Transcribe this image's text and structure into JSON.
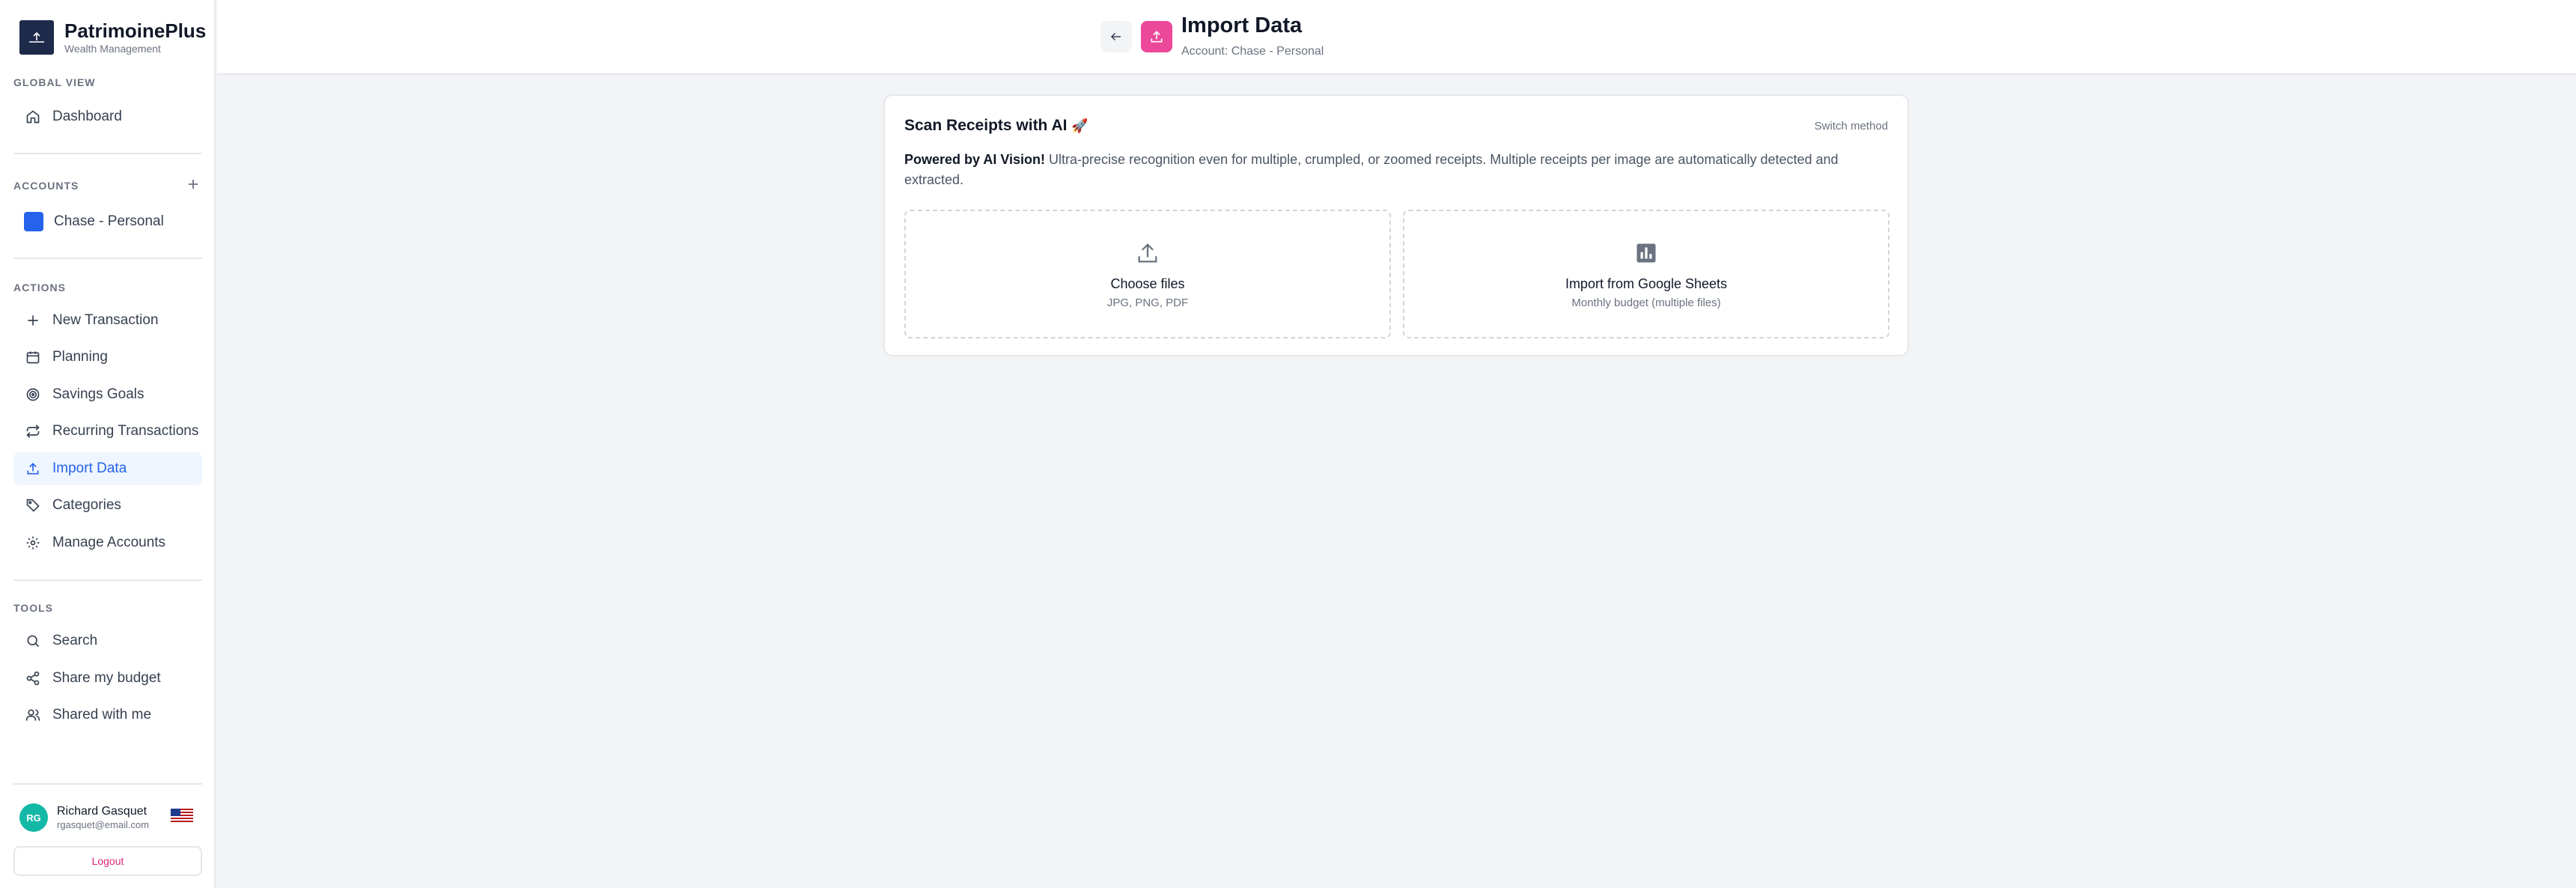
{
  "brand": {
    "name": "PatrimoinePlus",
    "subtitle": "Wealth Management"
  },
  "sidebar": {
    "global_view_title": "GLOBAL VIEW",
    "dashboard_label": "Dashboard",
    "accounts_title": "ACCOUNTS",
    "accounts": [
      {
        "label": "Chase - Personal",
        "color": "#2563eb"
      }
    ],
    "actions_title": "ACTIONS",
    "actions": [
      {
        "label": "New Transaction",
        "icon": "plus-icon"
      },
      {
        "label": "Planning",
        "icon": "calendar-icon"
      },
      {
        "label": "Savings Goals",
        "icon": "target-icon"
      },
      {
        "label": "Recurring Transactions",
        "icon": "repeat-icon"
      },
      {
        "label": "Import Data",
        "icon": "upload-icon",
        "active": true
      },
      {
        "label": "Categories",
        "icon": "tag-icon"
      },
      {
        "label": "Manage Accounts",
        "icon": "gear-icon"
      }
    ],
    "tools_title": "TOOLS",
    "tools": [
      {
        "label": "Search",
        "icon": "search-icon"
      },
      {
        "label": "Share my budget",
        "icon": "share-icon"
      },
      {
        "label": "Shared with me",
        "icon": "users-icon"
      }
    ]
  },
  "user": {
    "initials": "RG",
    "name": "Richard Gasquet",
    "email": "rgasquet@email.com",
    "logout_label": "Logout"
  },
  "header": {
    "title": "Import Data",
    "subtitle": "Account: Chase - Personal"
  },
  "card": {
    "title": "Scan Receipts with AI",
    "title_emoji": "🚀",
    "switch_label": "Switch method",
    "desc_bold": "Powered by AI Vision!",
    "desc_text": " Ultra-precise recognition even for multiple, crumpled, or zoomed receipts. Multiple receipts per image are automatically detected and extracted.",
    "options": [
      {
        "title": "Choose files",
        "subtitle": "JPG, PNG, PDF",
        "icon": "upload-icon"
      },
      {
        "title": "Import from Google Sheets",
        "subtitle": "Monthly budget (multiple files)",
        "icon": "bar-chart-icon"
      }
    ]
  },
  "colors": {
    "accent": "#2563eb",
    "pink": "#ec4899",
    "teal": "#14b8a6",
    "brand": "#1e2a4a"
  }
}
